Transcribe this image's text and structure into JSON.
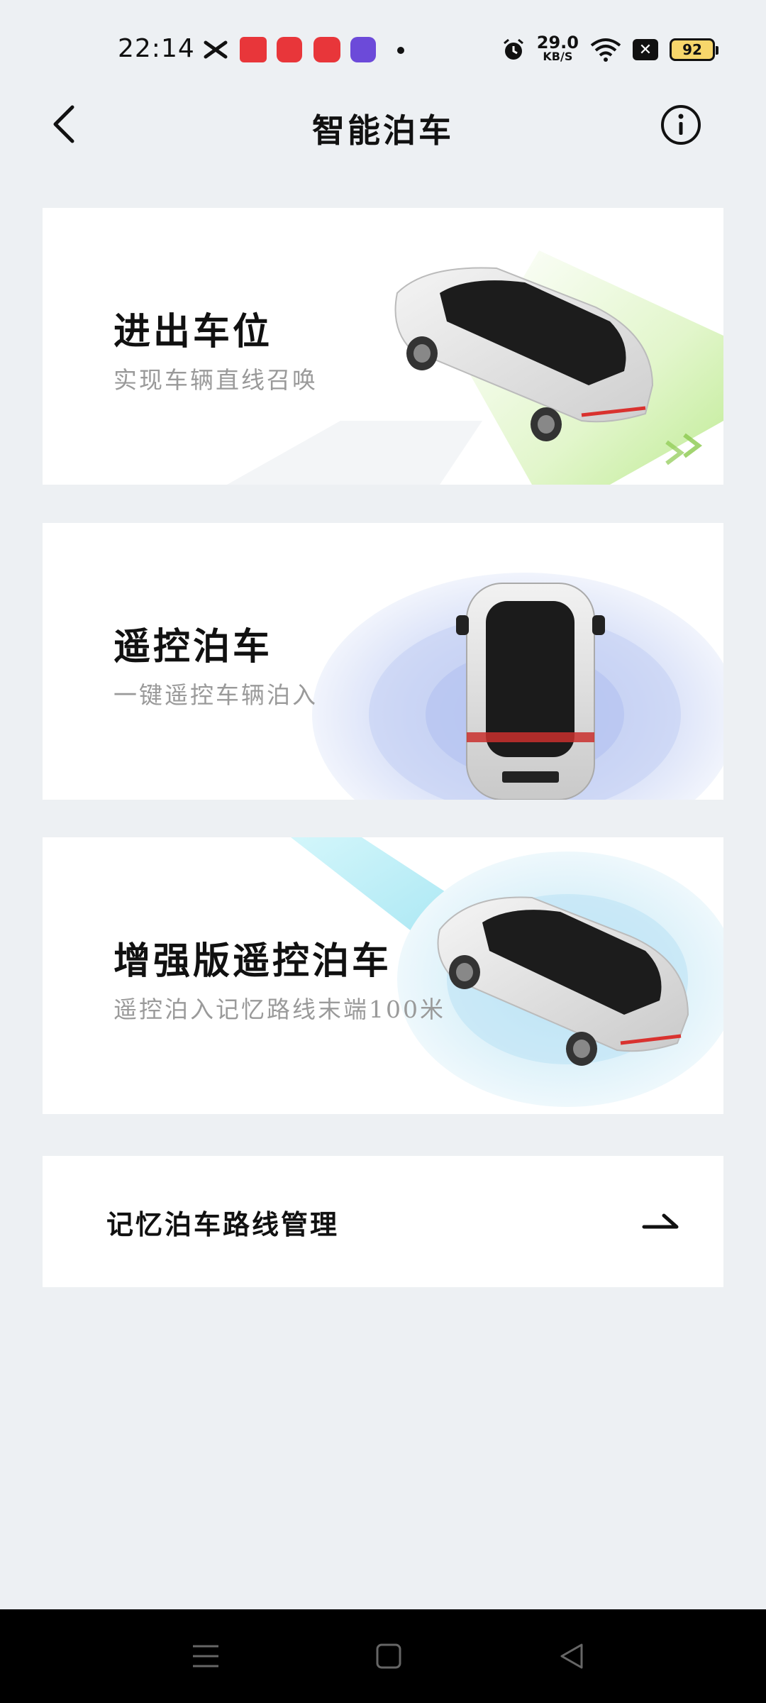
{
  "status_bar": {
    "time": "22:14",
    "notifications": [
      "x-app-icon",
      "toutiao-icon",
      "netease-music-icon",
      "xiaohongshu-icon",
      "tieba-icon"
    ],
    "net_speed_value": "29.0",
    "net_speed_unit": "KB/S",
    "battery": "92"
  },
  "header": {
    "title": "智能泊车"
  },
  "cards": [
    {
      "title": "进出车位",
      "subtitle": "实现车辆直线召唤"
    },
    {
      "title": "遥控泊车",
      "subtitle": "一键遥控车辆泊入"
    },
    {
      "title": "增强版遥控泊车",
      "subtitle": "遥控泊入记忆路线末端100米"
    }
  ],
  "route_management": {
    "label": "记忆泊车路线管理"
  },
  "colors": {
    "background": "#edf0f3",
    "card": "#ffffff",
    "green_path": "#b9e98a",
    "blue_radar": "#c8d4f5",
    "cyan_beam": "#a6ecf5"
  }
}
